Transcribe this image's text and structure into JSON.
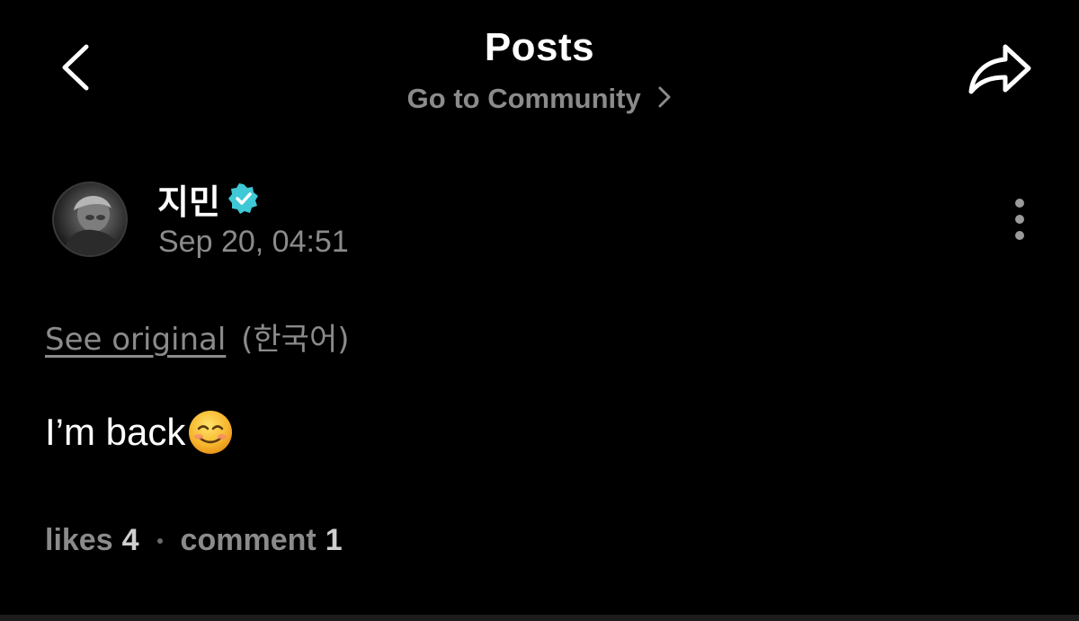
{
  "header": {
    "title": "Posts",
    "community_link": "Go to Community",
    "back_icon": "chevron-left-icon",
    "share_icon": "share-arrow-icon"
  },
  "post": {
    "author": "지민",
    "verified": true,
    "date": "Sep 20, 04:51",
    "see_original": "See original",
    "language": "(한국어)",
    "body_text": "I’m back",
    "body_emoji": "smiling-face-emoji",
    "likes_label": "likes",
    "likes_count": "4",
    "comment_label": "comment",
    "comment_count": "1"
  },
  "colors": {
    "background": "#000000",
    "primary_text": "#ffffff",
    "secondary_text": "#8b8b8b",
    "verified_badge": "#3fc8d6"
  }
}
